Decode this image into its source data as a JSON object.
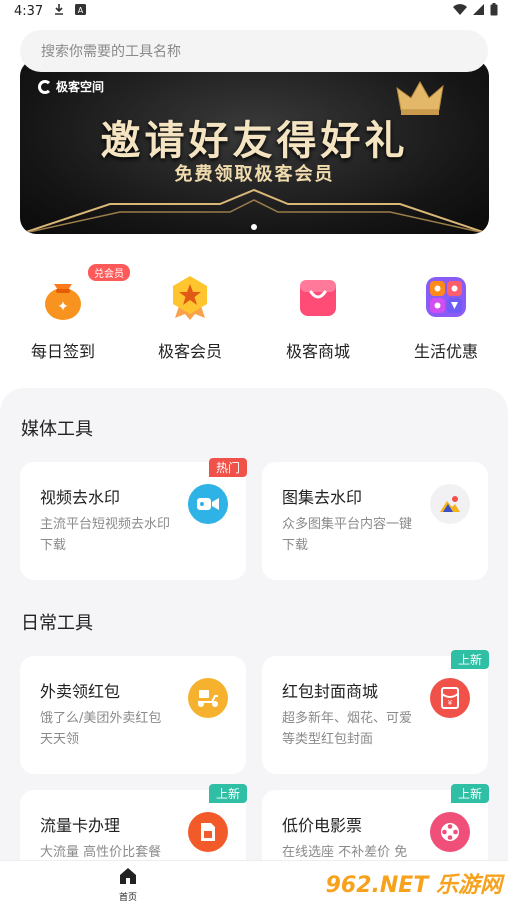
{
  "status_bar": {
    "time": "4:37",
    "icons": [
      "download-icon",
      "a-icon",
      "wifi-icon",
      "signal-icon",
      "battery-icon"
    ]
  },
  "search": {
    "placeholder": "搜索你需要的工具名称"
  },
  "banner": {
    "brand": "极客空间",
    "title": "邀请好友得好礼",
    "subtitle": "免费领取极客会员"
  },
  "quick_actions": [
    {
      "label": "每日签到",
      "icon": "money-bag-icon",
      "badge": "兑会员"
    },
    {
      "label": "极客会员",
      "icon": "vip-badge-icon"
    },
    {
      "label": "极客商城",
      "icon": "shopping-bag-icon"
    },
    {
      "label": "生活优惠",
      "icon": "lifestyle-grid-icon"
    }
  ],
  "sections": [
    {
      "title": "媒体工具",
      "cards": [
        {
          "title": "视频去水印",
          "desc": "主流平台短视频去水印下载",
          "icon": "video-camera-icon",
          "tag": "热门",
          "tag_color": "#f0524a",
          "icon_bg": "#2fb2e6"
        },
        {
          "title": "图集去水印",
          "desc": "众多图集平台内容一键下载",
          "icon": "gallery-icon",
          "tag": "",
          "icon_bg": "#f1f1f4"
        }
      ]
    },
    {
      "title": "日常工具",
      "cards": [
        {
          "title": "外卖领红包",
          "desc": "饿了么/美团外卖红包天天领",
          "icon": "delivery-scooter-icon",
          "tag": "",
          "icon_bg": "#f6b22e"
        },
        {
          "title": "红包封面商城",
          "desc": "超多新年、烟花、可爱等类型红包封面",
          "icon": "red-envelope-icon",
          "tag": "上新",
          "tag_color": "#2fbfa5",
          "icon_bg": "#f0524a"
        },
        {
          "title": "流量卡办理",
          "desc": "大流量 高性价比套餐",
          "icon": "sim-card-icon",
          "tag": "上新",
          "tag_color": "#2fbfa5",
          "icon_bg": "#f35a2a"
        },
        {
          "title": "低价电影票",
          "desc": "在线选座 不补差价 免",
          "icon": "film-reel-icon",
          "tag": "上新",
          "tag_color": "#2fbfa5",
          "icon_bg": "#ef4f79"
        }
      ]
    }
  ],
  "tab_bar": {
    "home_label": "首页"
  },
  "watermark": "962.NET 乐游网"
}
